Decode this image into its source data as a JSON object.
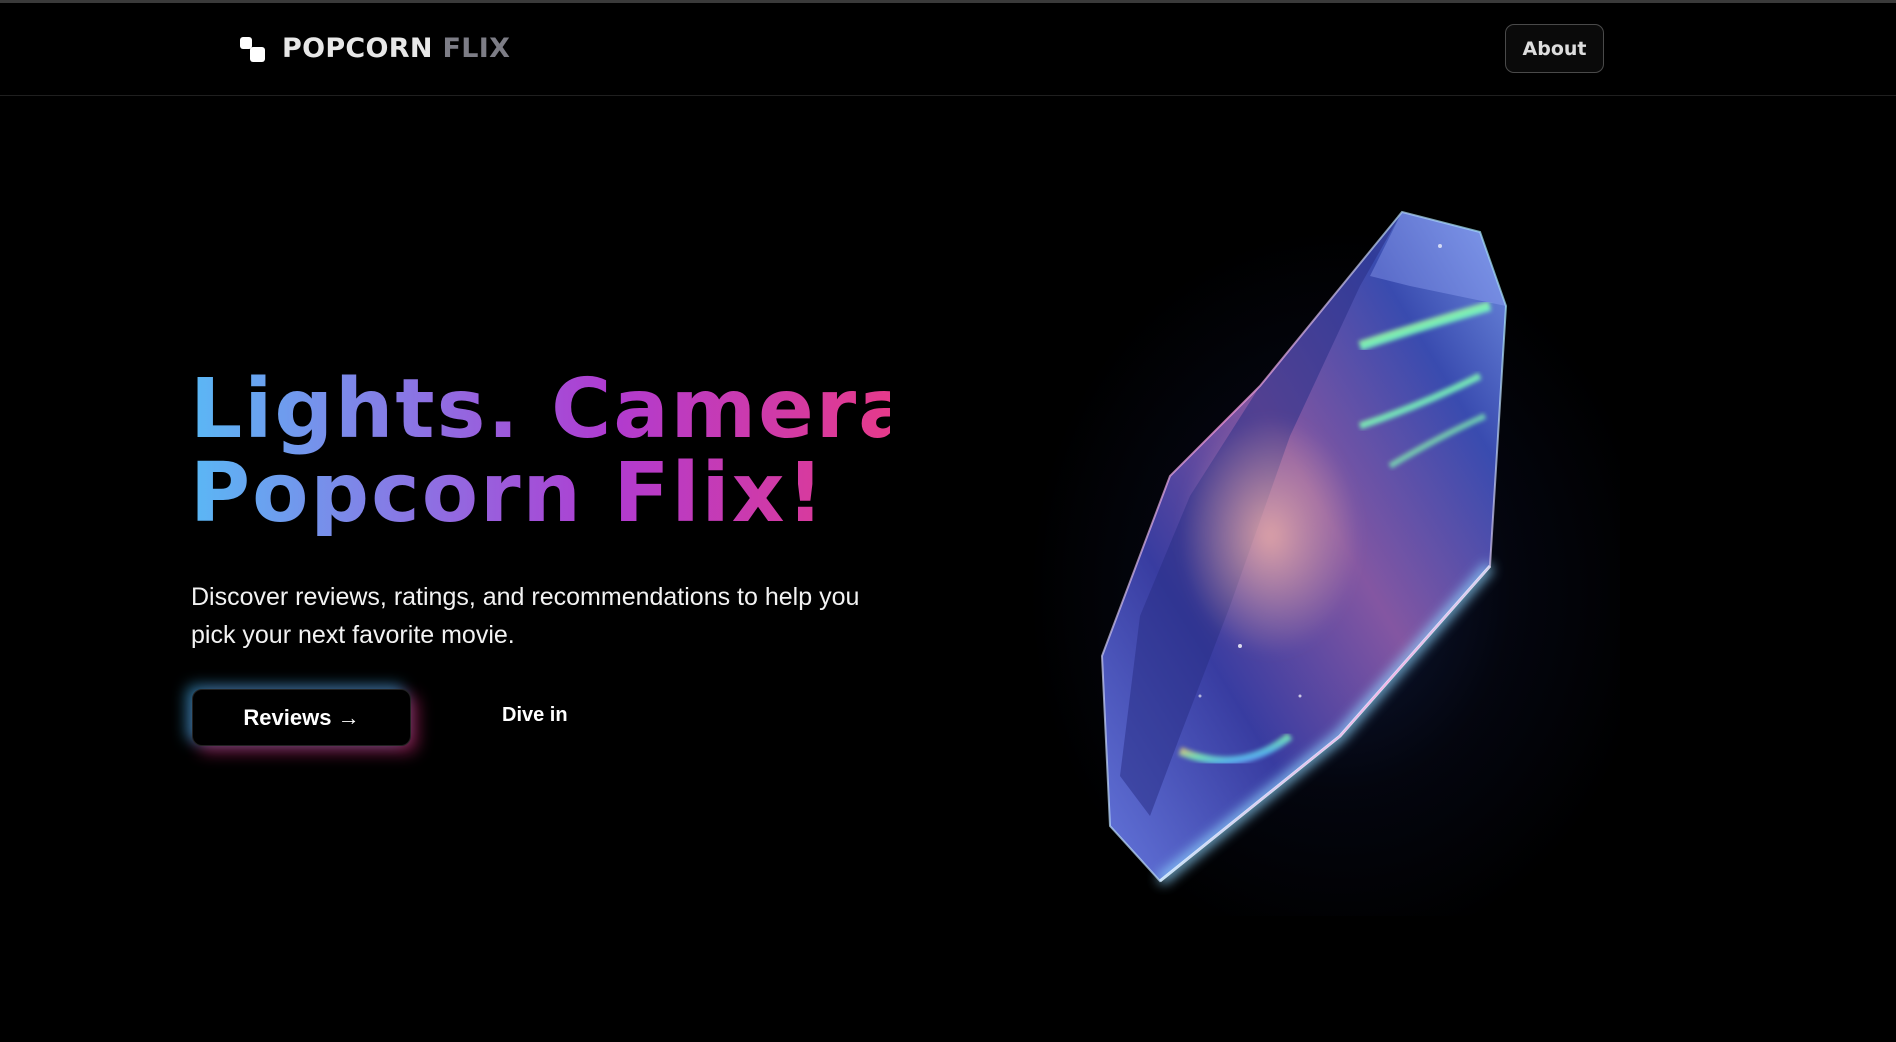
{
  "header": {
    "logo_text_primary": "POPCORN",
    "logo_text_secondary": "FLIX",
    "about_label": "About"
  },
  "hero": {
    "title_line1": "Lights. Camera.",
    "title_line2": "Popcorn Flix!",
    "subtitle": "Discover reviews, ratings, and recommendations to help you pick your next favorite movie.",
    "primary_button_label": "Reviews →",
    "secondary_link_label": "Dive in"
  },
  "colors": {
    "background": "#000000",
    "gradient_start": "#5ab8f5",
    "gradient_mid": "#b03bd0",
    "gradient_end": "#e63a8b"
  },
  "illustration": {
    "icon": "crystal-3d-illustration"
  }
}
